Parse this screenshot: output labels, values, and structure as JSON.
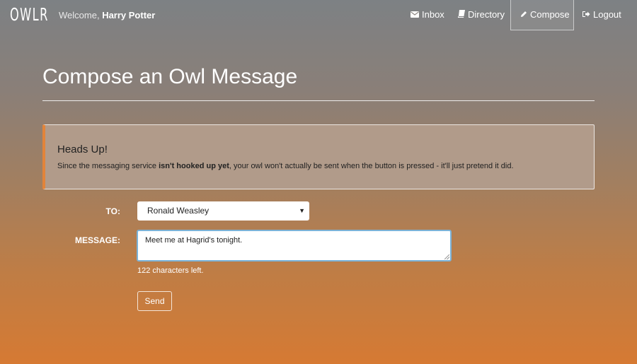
{
  "brand": "OWLR",
  "header": {
    "welcome_prefix": "Welcome,",
    "user_name": "Harry Potter",
    "nav": [
      {
        "label": "Inbox",
        "icon": "envelope-icon"
      },
      {
        "label": "Directory",
        "icon": "book-icon"
      },
      {
        "label": "Compose",
        "icon": "pencil-icon",
        "active": true
      },
      {
        "label": "Logout",
        "icon": "logout-icon"
      }
    ]
  },
  "page": {
    "title": "Compose an Owl Message"
  },
  "alert": {
    "title": "Heads Up!",
    "text_before": "Since the messaging service ",
    "text_bold": "isn't hooked up yet",
    "text_after": ", your owl won't actually be sent when the button is pressed - it'll just pretend it did."
  },
  "form": {
    "to_label": "TO:",
    "to_value": "Ronald Weasley",
    "message_label": "MESSAGE:",
    "message_value": "Meet me at Hagrid's tonight.",
    "chars_left": "122 characters left.",
    "send_label": "Send"
  },
  "colors": {
    "alert_accent": "#e2843a",
    "focus_border": "#7bb3d8"
  }
}
